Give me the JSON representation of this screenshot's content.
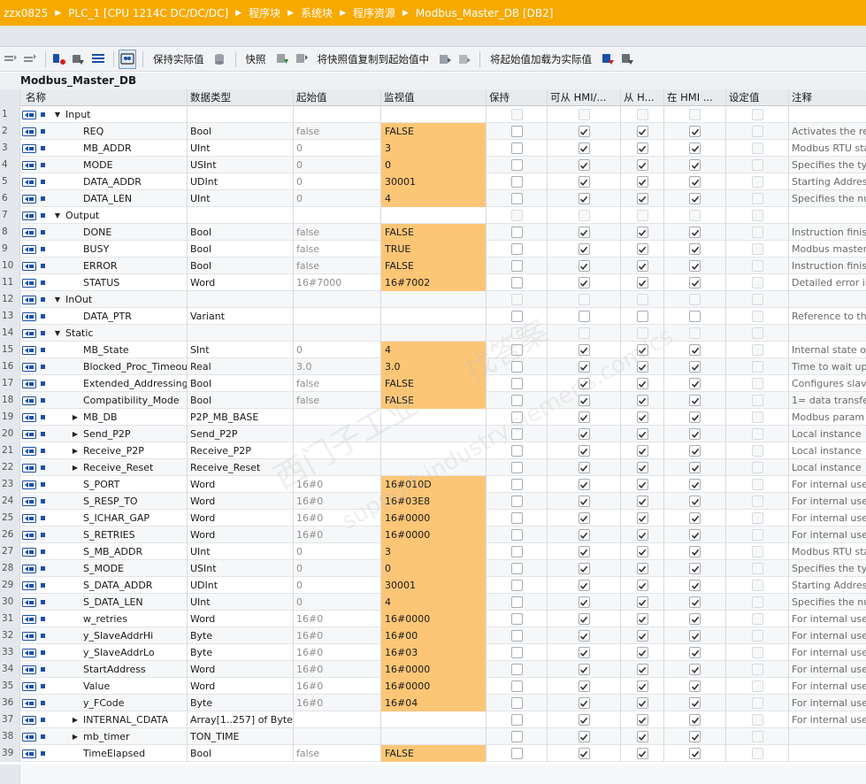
{
  "breadcrumb": [
    "zzx0825",
    "PLC_1 [CPU 1214C DC/DC/DC]",
    "程序块",
    "系统块",
    "程序资源",
    "Modbus_Master_DB [DB2]"
  ],
  "toolbar": {
    "keep_actual": "保持实际值",
    "snapshot": "快照",
    "copy_snapshot": "将快照值复制到起始值中",
    "load_start": "将起始值加载为实际值"
  },
  "db_title": "Modbus_Master_DB",
  "headers": [
    "名称",
    "数据类型",
    "起始值",
    "监视值",
    "保持",
    "可从 HMI/...",
    "从 H...",
    "在 HMI ...",
    "设定值",
    "注释"
  ],
  "rows": [
    {
      "n": "1",
      "lvl": 0,
      "exp": "open",
      "name": "Input",
      "type": "",
      "start": "",
      "mon": "",
      "keep": false,
      "hmi1": false,
      "hmi2": false,
      "hmi3": false,
      "set": false,
      "sect": true,
      "comment": ""
    },
    {
      "n": "2",
      "lvl": 1,
      "exp": "",
      "name": "REQ",
      "type": "Bool",
      "start": "false",
      "mon": "FALSE",
      "keep": false,
      "hmi1": true,
      "hmi2": true,
      "hmi3": true,
      "set": false,
      "comment": "Activates the re"
    },
    {
      "n": "3",
      "lvl": 1,
      "exp": "",
      "name": "MB_ADDR",
      "type": "UInt",
      "start": "0",
      "mon": "3",
      "keep": false,
      "hmi1": true,
      "hmi2": true,
      "hmi3": true,
      "set": false,
      "comment": "Modbus RTU sta"
    },
    {
      "n": "4",
      "lvl": 1,
      "exp": "",
      "name": "MODE",
      "type": "USInt",
      "start": "0",
      "mon": "0",
      "keep": false,
      "hmi1": true,
      "hmi2": true,
      "hmi3": true,
      "set": false,
      "comment": "Specifies the ty"
    },
    {
      "n": "5",
      "lvl": 1,
      "exp": "",
      "name": "DATA_ADDR",
      "type": "UDInt",
      "start": "0",
      "mon": "30001",
      "keep": false,
      "hmi1": true,
      "hmi2": true,
      "hmi3": true,
      "set": false,
      "comment": "Starting Addres"
    },
    {
      "n": "6",
      "lvl": 1,
      "exp": "",
      "name": "DATA_LEN",
      "type": "UInt",
      "start": "0",
      "mon": "4",
      "keep": false,
      "hmi1": true,
      "hmi2": true,
      "hmi3": true,
      "set": false,
      "comment": "Specifies the nu"
    },
    {
      "n": "7",
      "lvl": 0,
      "exp": "open",
      "name": "Output",
      "type": "",
      "start": "",
      "mon": "",
      "keep": false,
      "hmi1": false,
      "hmi2": false,
      "hmi3": false,
      "set": false,
      "sect": true,
      "comment": ""
    },
    {
      "n": "8",
      "lvl": 1,
      "exp": "",
      "name": "DONE",
      "type": "Bool",
      "start": "false",
      "mon": "FALSE",
      "keep": false,
      "hmi1": true,
      "hmi2": true,
      "hmi3": true,
      "set": false,
      "comment": "Instruction finis"
    },
    {
      "n": "9",
      "lvl": 1,
      "exp": "",
      "name": "BUSY",
      "type": "Bool",
      "start": "false",
      "mon": "TRUE",
      "keep": false,
      "hmi1": true,
      "hmi2": true,
      "hmi3": true,
      "set": false,
      "comment": "Modbus master"
    },
    {
      "n": "10",
      "lvl": 1,
      "exp": "",
      "name": "ERROR",
      "type": "Bool",
      "start": "false",
      "mon": "FALSE",
      "keep": false,
      "hmi1": true,
      "hmi2": true,
      "hmi3": true,
      "set": false,
      "comment": "Instruction finis"
    },
    {
      "n": "11",
      "lvl": 1,
      "exp": "",
      "name": "STATUS",
      "type": "Word",
      "start": "16#7000",
      "mon": "16#7002",
      "keep": false,
      "hmi1": true,
      "hmi2": true,
      "hmi3": true,
      "set": false,
      "comment": "Detailed error in"
    },
    {
      "n": "12",
      "lvl": 0,
      "exp": "open",
      "name": "InOut",
      "type": "",
      "start": "",
      "mon": "",
      "keep": false,
      "hmi1": false,
      "hmi2": false,
      "hmi3": false,
      "set": false,
      "sect": true,
      "comment": ""
    },
    {
      "n": "13",
      "lvl": 1,
      "exp": "",
      "name": "DATA_PTR",
      "type": "Variant",
      "start": "",
      "mon": "",
      "keep": false,
      "hmi1": false,
      "hmi2": false,
      "hmi3": false,
      "set": false,
      "comment": "Reference to th"
    },
    {
      "n": "14",
      "lvl": 0,
      "exp": "open",
      "name": "Static",
      "type": "",
      "start": "",
      "mon": "",
      "keep": false,
      "hmi1": false,
      "hmi2": false,
      "hmi3": false,
      "set": false,
      "sect": true,
      "comment": ""
    },
    {
      "n": "15",
      "lvl": 1,
      "exp": "",
      "name": "MB_State",
      "type": "SInt",
      "start": "0",
      "mon": "4",
      "keep": false,
      "hmi1": true,
      "hmi2": true,
      "hmi3": true,
      "set": false,
      "comment": "Internal state o"
    },
    {
      "n": "16",
      "lvl": 1,
      "exp": "",
      "name": "Blocked_Proc_Timeout",
      "type": "Real",
      "start": "3.0",
      "mon": "3.0",
      "keep": false,
      "hmi1": true,
      "hmi2": true,
      "hmi3": true,
      "set": false,
      "comment": "Time to wait up"
    },
    {
      "n": "17",
      "lvl": 1,
      "exp": "",
      "name": "Extended_Addressing",
      "type": "Bool",
      "start": "false",
      "mon": "FALSE",
      "keep": false,
      "hmi1": true,
      "hmi2": true,
      "hmi3": true,
      "set": false,
      "comment": "Configures slav"
    },
    {
      "n": "18",
      "lvl": 1,
      "exp": "",
      "name": "Compatibility_Mode",
      "type": "Bool",
      "start": "false",
      "mon": "FALSE",
      "keep": false,
      "hmi1": true,
      "hmi2": true,
      "hmi3": true,
      "set": false,
      "comment": "1= data transfe"
    },
    {
      "n": "19",
      "lvl": 1,
      "exp": "closed",
      "name": "MB_DB",
      "type": "P2P_MB_BASE",
      "start": "",
      "mon": "",
      "keep": false,
      "hmi1": true,
      "hmi2": true,
      "hmi3": true,
      "set": false,
      "comment": "Modbus param"
    },
    {
      "n": "20",
      "lvl": 1,
      "exp": "closed",
      "name": "Send_P2P",
      "type": "Send_P2P",
      "start": "",
      "mon": "",
      "keep": false,
      "hmi1": true,
      "hmi2": true,
      "hmi3": true,
      "set": false,
      "comment": "Local instance"
    },
    {
      "n": "21",
      "lvl": 1,
      "exp": "closed",
      "name": "Receive_P2P",
      "type": "Receive_P2P",
      "start": "",
      "mon": "",
      "keep": false,
      "hmi1": true,
      "hmi2": true,
      "hmi3": true,
      "set": false,
      "comment": "Local instance"
    },
    {
      "n": "22",
      "lvl": 1,
      "exp": "closed",
      "name": "Receive_Reset",
      "type": "Receive_Reset",
      "start": "",
      "mon": "",
      "keep": false,
      "hmi1": true,
      "hmi2": true,
      "hmi3": true,
      "set": false,
      "comment": "Local instance"
    },
    {
      "n": "23",
      "lvl": 1,
      "exp": "",
      "name": "S_PORT",
      "type": "Word",
      "start": "16#0",
      "mon": "16#010D",
      "keep": false,
      "hmi1": true,
      "hmi2": true,
      "hmi3": true,
      "set": false,
      "comment": "For internal use"
    },
    {
      "n": "24",
      "lvl": 1,
      "exp": "",
      "name": "S_RESP_TO",
      "type": "Word",
      "start": "16#0",
      "mon": "16#03E8",
      "keep": false,
      "hmi1": true,
      "hmi2": true,
      "hmi3": true,
      "set": false,
      "comment": "For internal use"
    },
    {
      "n": "25",
      "lvl": 1,
      "exp": "",
      "name": "S_ICHAR_GAP",
      "type": "Word",
      "start": "16#0",
      "mon": "16#0000",
      "keep": false,
      "hmi1": true,
      "hmi2": true,
      "hmi3": true,
      "set": false,
      "comment": "For internal use"
    },
    {
      "n": "26",
      "lvl": 1,
      "exp": "",
      "name": "S_RETRIES",
      "type": "Word",
      "start": "16#0",
      "mon": "16#0000",
      "keep": false,
      "hmi1": true,
      "hmi2": true,
      "hmi3": true,
      "set": false,
      "comment": "For internal use"
    },
    {
      "n": "27",
      "lvl": 1,
      "exp": "",
      "name": "S_MB_ADDR",
      "type": "UInt",
      "start": "0",
      "mon": "3",
      "keep": false,
      "hmi1": true,
      "hmi2": true,
      "hmi3": true,
      "set": false,
      "comment": "Modbus RTU sta"
    },
    {
      "n": "28",
      "lvl": 1,
      "exp": "",
      "name": "S_MODE",
      "type": "USInt",
      "start": "0",
      "mon": "0",
      "keep": false,
      "hmi1": true,
      "hmi2": true,
      "hmi3": true,
      "set": false,
      "comment": "Specifies the ty"
    },
    {
      "n": "29",
      "lvl": 1,
      "exp": "",
      "name": "S_DATA_ADDR",
      "type": "UDInt",
      "start": "0",
      "mon": "30001",
      "keep": false,
      "hmi1": true,
      "hmi2": true,
      "hmi3": true,
      "set": false,
      "comment": "Starting Addres"
    },
    {
      "n": "30",
      "lvl": 1,
      "exp": "",
      "name": "S_DATA_LEN",
      "type": "UInt",
      "start": "0",
      "mon": "4",
      "keep": false,
      "hmi1": true,
      "hmi2": true,
      "hmi3": true,
      "set": false,
      "comment": "Specifies the nu"
    },
    {
      "n": "31",
      "lvl": 1,
      "exp": "",
      "name": "w_retries",
      "type": "Word",
      "start": "16#0",
      "mon": "16#0000",
      "keep": false,
      "hmi1": true,
      "hmi2": true,
      "hmi3": true,
      "set": false,
      "comment": "For internal use"
    },
    {
      "n": "32",
      "lvl": 1,
      "exp": "",
      "name": "y_SlaveAddrHi",
      "type": "Byte",
      "start": "16#0",
      "mon": "16#00",
      "keep": false,
      "hmi1": true,
      "hmi2": true,
      "hmi3": true,
      "set": false,
      "comment": "For internal use"
    },
    {
      "n": "33",
      "lvl": 1,
      "exp": "",
      "name": "y_SlaveAddrLo",
      "type": "Byte",
      "start": "16#0",
      "mon": "16#03",
      "keep": false,
      "hmi1": true,
      "hmi2": true,
      "hmi3": true,
      "set": false,
      "comment": "For internal use"
    },
    {
      "n": "34",
      "lvl": 1,
      "exp": "",
      "name": "StartAddress",
      "type": "Word",
      "start": "16#0",
      "mon": "16#0000",
      "keep": false,
      "hmi1": true,
      "hmi2": true,
      "hmi3": true,
      "set": false,
      "comment": "For internal use"
    },
    {
      "n": "35",
      "lvl": 1,
      "exp": "",
      "name": "Value",
      "type": "Word",
      "start": "16#0",
      "mon": "16#0000",
      "keep": false,
      "hmi1": true,
      "hmi2": true,
      "hmi3": true,
      "set": false,
      "comment": "For internal use"
    },
    {
      "n": "36",
      "lvl": 1,
      "exp": "",
      "name": "y_FCode",
      "type": "Byte",
      "start": "16#0",
      "mon": "16#04",
      "keep": false,
      "hmi1": true,
      "hmi2": true,
      "hmi3": true,
      "set": false,
      "comment": "For internal use"
    },
    {
      "n": "37",
      "lvl": 1,
      "exp": "closed",
      "name": "INTERNAL_CDATA",
      "type": "Array[1..257] of Byte",
      "start": "",
      "mon": "",
      "keep": false,
      "hmi1": true,
      "hmi2": true,
      "hmi3": true,
      "set": false,
      "comment": "For internal use"
    },
    {
      "n": "38",
      "lvl": 1,
      "exp": "closed",
      "name": "mb_timer",
      "type": "TON_TIME",
      "start": "",
      "mon": "",
      "keep": false,
      "hmi1": true,
      "hmi2": true,
      "hmi3": true,
      "set": false,
      "comment": ""
    },
    {
      "n": "39",
      "lvl": 1,
      "exp": "",
      "name": "TimeElapsed",
      "type": "Bool",
      "start": "false",
      "mon": "FALSE",
      "keep": false,
      "hmi1": true,
      "hmi2": true,
      "hmi3": true,
      "set": false,
      "comment": ""
    }
  ],
  "watermark": {
    "line1": "找答案",
    "line2": "西门子工业",
    "line3": "support.industry.siemens.com/cs"
  },
  "colors": {
    "title_bar": "#f7a900",
    "monitor_highlight": "#fdc676",
    "icon_blue": "#1c4fa8"
  }
}
